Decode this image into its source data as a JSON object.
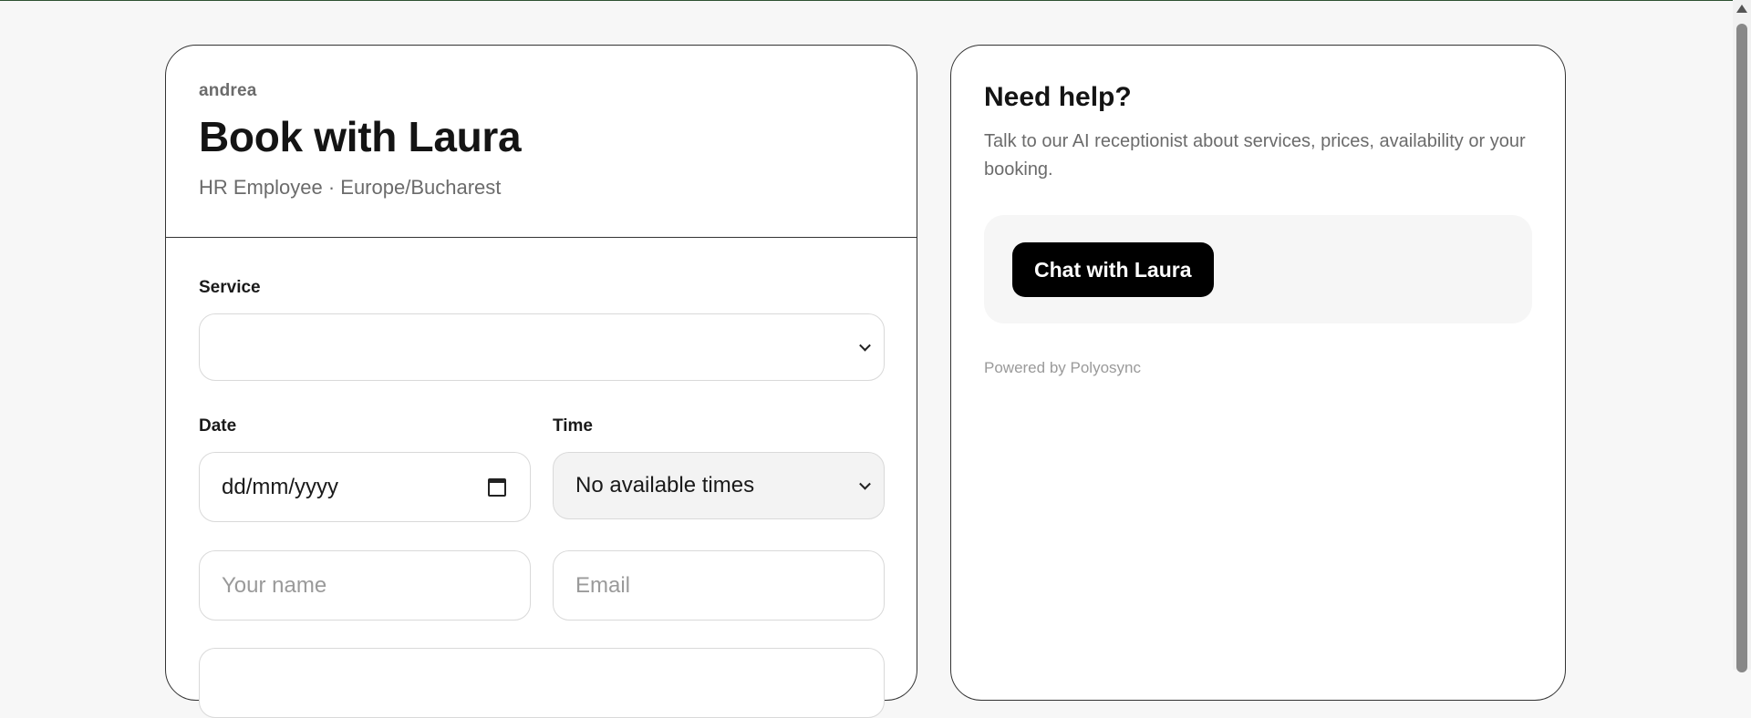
{
  "booking": {
    "business_name": "andrea",
    "title": "Book with Laura",
    "subtitle": "HR Employee · Europe/Bucharest"
  },
  "form": {
    "service_label": "Service",
    "service_value": "",
    "date_label": "Date",
    "date_placeholder": "dd/mm/yyyy",
    "time_label": "Time",
    "time_value": "No available times",
    "name_placeholder": "Your name",
    "email_placeholder": "Email"
  },
  "help": {
    "title": "Need help?",
    "description": "Talk to our AI receptionist about services, prices, availability or your booking.",
    "chat_button": "Chat with Laura",
    "powered_by": "Powered by Polyosync"
  },
  "icons": {
    "chevron": "chevron-down-icon",
    "calendar": "calendar-icon"
  }
}
